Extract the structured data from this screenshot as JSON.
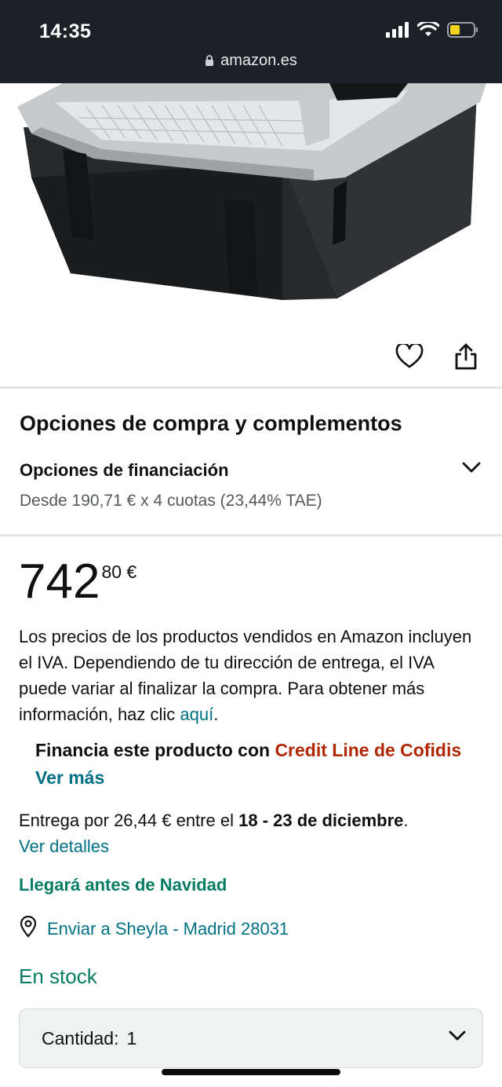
{
  "status_bar": {
    "time": "14:35",
    "icons": [
      "signal-icon",
      "wifi-icon",
      "battery-icon"
    ],
    "battery_color": "#f2d31b"
  },
  "browser": {
    "url": "amazon.es"
  },
  "product": {
    "image_alt": "portable fridge product image",
    "actions": [
      "heart-icon",
      "share-icon"
    ]
  },
  "buy_options": {
    "title": "Opciones de compra y complementos",
    "financing_title": "Opciones de financiación",
    "financing_subtitle": "Desde 190,71 € x 4 cuotas (23,44% TAE)"
  },
  "price": {
    "whole": "742",
    "fraction": "80 €"
  },
  "vat": {
    "text": "Los precios de los productos vendidos en Amazon incluyen el IVA. Dependiendo de tu dirección de entrega, el IVA puede variar al finalizar la compra. Para obtener más información, haz clic ",
    "link": "aquí",
    "end": "."
  },
  "financia": {
    "prefix": "Financia este producto con ",
    "brand": "Credit Line de Cofidis",
    "more": "Ver más"
  },
  "delivery": {
    "prefix": "Entrega por 26,44 € entre el ",
    "dates": "18 - 23 de diciembre",
    "suffix": ".",
    "details_link": "Ver detalles"
  },
  "christmas_notice": "Llegará antes de Navidad",
  "ship_to": "Enviar a Sheyla - Madrid 28031",
  "stock_status": "En stock",
  "quantity": {
    "label": "Cantidad:",
    "value": "1"
  },
  "colors": {
    "link": "#007185",
    "green": "#067d62",
    "price_red": "#b12704"
  }
}
